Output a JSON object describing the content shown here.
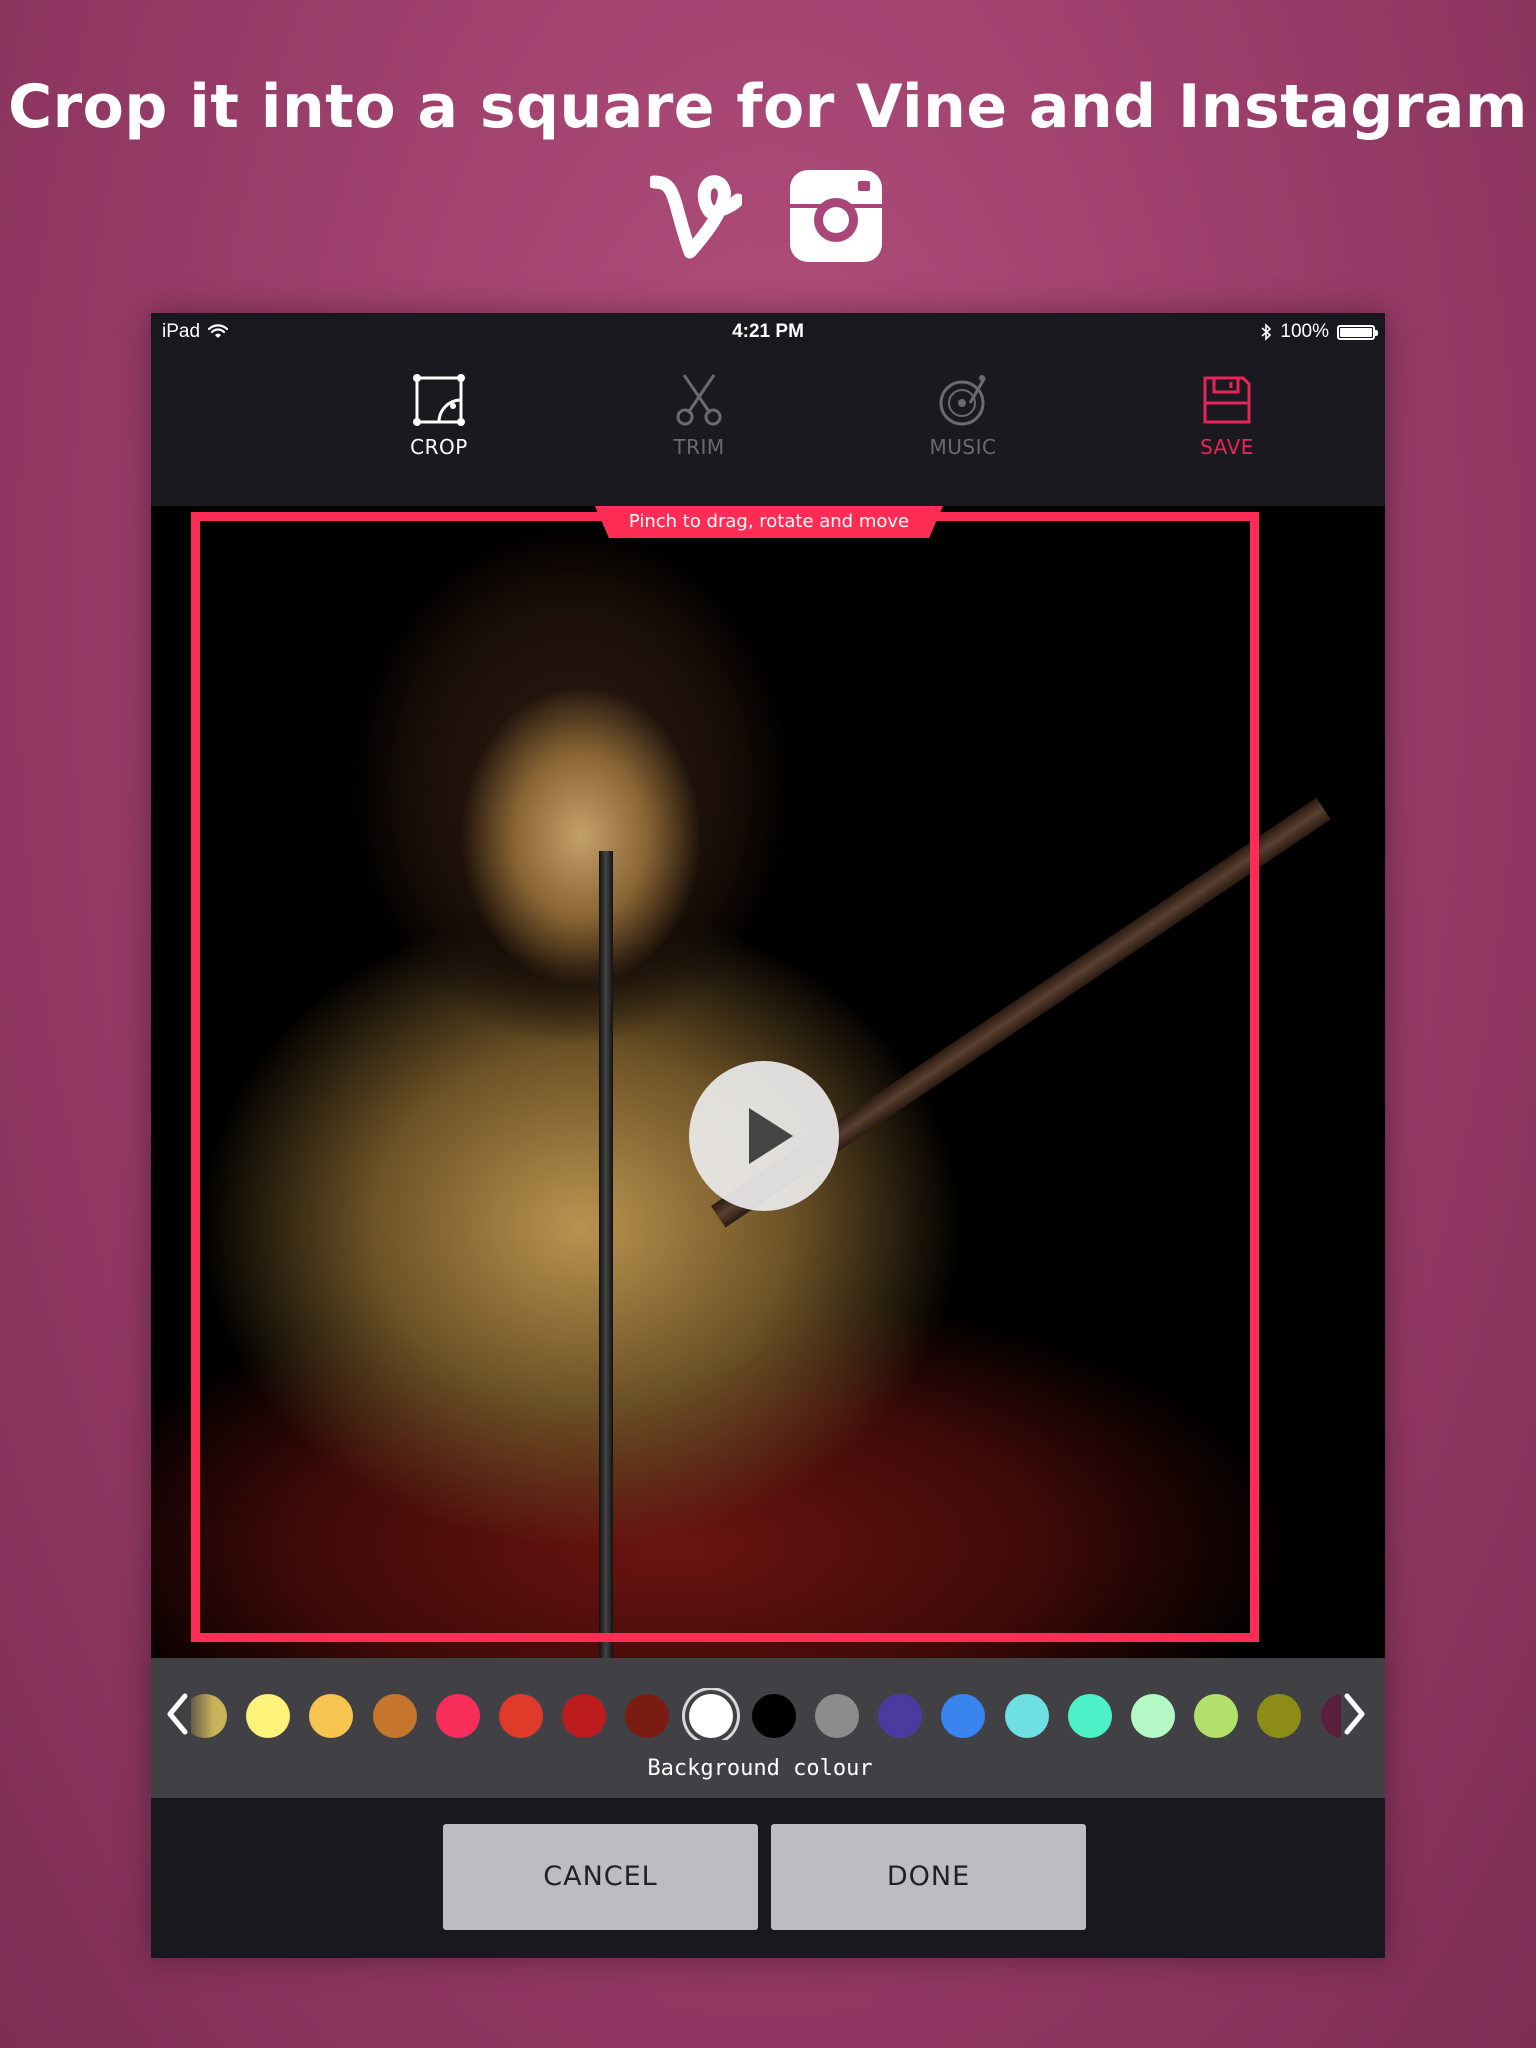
{
  "headline": "Crop it into a square for Vine and Instagram",
  "social_icons": [
    "vine-logo-icon",
    "instagram-logo-icon"
  ],
  "status_bar": {
    "device": "iPad",
    "time": "4:21 PM",
    "battery": "100%"
  },
  "toolbar": {
    "tools": [
      {
        "label": "CROP",
        "icon": "crop-icon",
        "color": "#ffffff"
      },
      {
        "label": "TRIM",
        "icon": "scissors-icon",
        "color": "#6b6a70"
      },
      {
        "label": "MUSIC",
        "icon": "music-record-icon",
        "color": "#6b6a70"
      },
      {
        "label": "SAVE",
        "icon": "floppy-disk-icon",
        "color": "#e8245a"
      }
    ]
  },
  "editor": {
    "hint": "Pinch to drag, rotate and move",
    "accent_color": "#ff2d55"
  },
  "palette": {
    "label": "Background colour",
    "colors": [
      "#c9b35a",
      "#fdf27a",
      "#f7c44f",
      "#c6752c",
      "#f72d5a",
      "#e03a2a",
      "#bd1c1f",
      "#7a1c12",
      "#ffffff",
      "#000000",
      "#8c8c8c",
      "#4d3aa0",
      "#3a84f0",
      "#6ee0e4",
      "#4ef0c8",
      "#b4f8c6",
      "#b2e06a",
      "#8d8c16",
      "#5a1f3c"
    ],
    "selected_index": 8
  },
  "actions": {
    "cancel": "CANCEL",
    "done": "DONE"
  }
}
